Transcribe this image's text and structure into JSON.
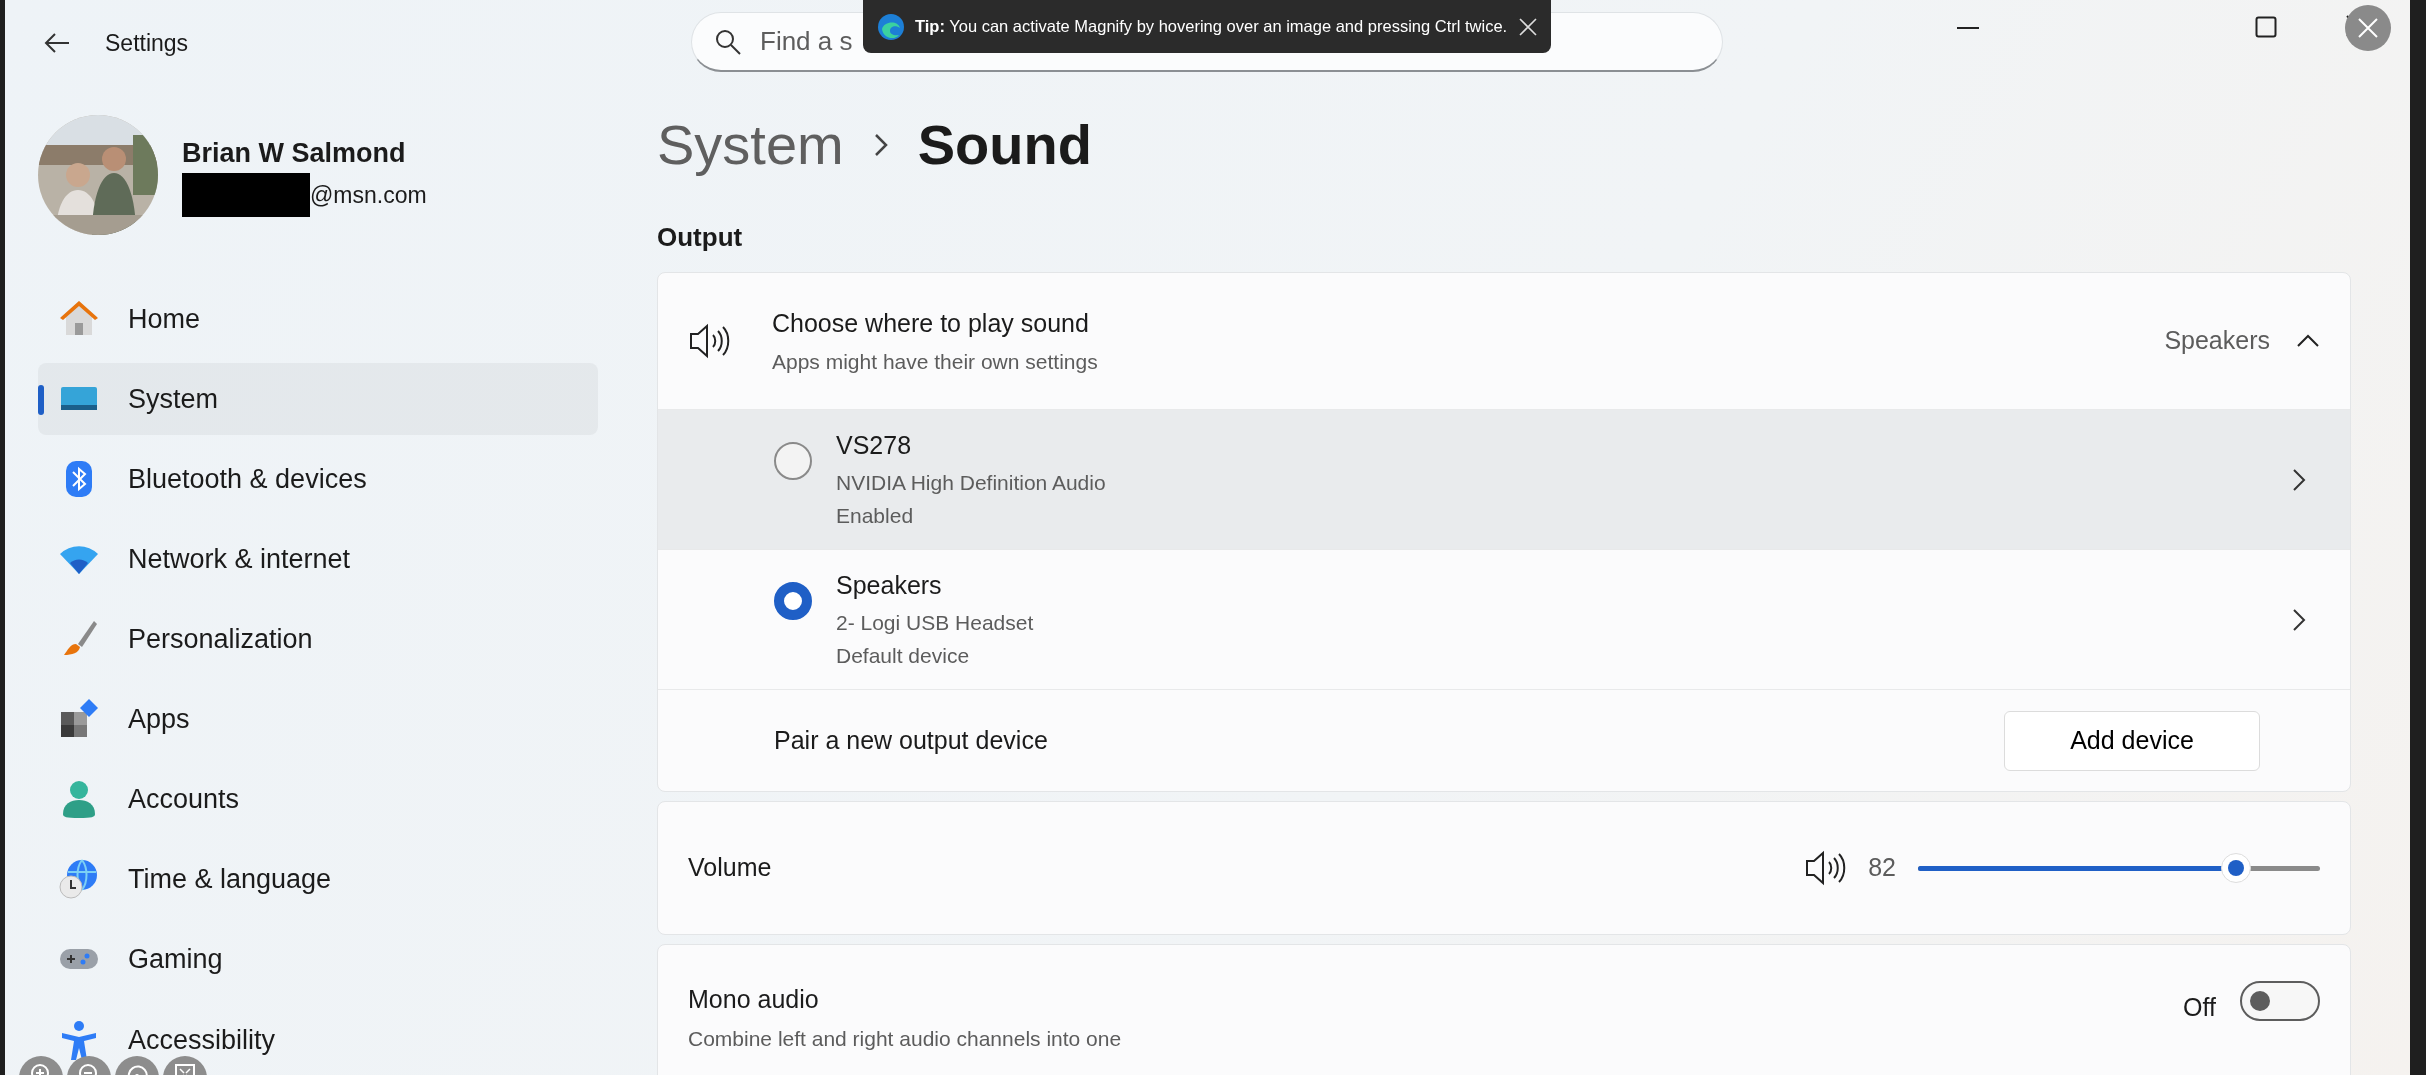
{
  "window": {
    "title": "Settings"
  },
  "search": {
    "placeholder": "Find a s"
  },
  "tip": {
    "text": "**Tip:** You can activate Magnify by hovering over an image and pressing Ctrl twice."
  },
  "profile": {
    "name": "Brian W Salmond",
    "email": "@msn.com"
  },
  "sidebar": {
    "items": [
      {
        "label": "Home",
        "selected": false
      },
      {
        "label": "System",
        "selected": true
      },
      {
        "label": "Bluetooth & devices",
        "selected": false
      },
      {
        "label": "Network & internet",
        "selected": false
      },
      {
        "label": "Personalization",
        "selected": false
      },
      {
        "label": "Apps",
        "selected": false
      },
      {
        "label": "Accounts",
        "selected": false
      },
      {
        "label": "Time & language",
        "selected": false
      },
      {
        "label": "Gaming",
        "selected": false
      },
      {
        "label": "Accessibility",
        "selected": false
      }
    ]
  },
  "breadcrumb": [
    "System",
    "Sound"
  ],
  "section": "Output",
  "output": {
    "title": "Choose where to play sound",
    "subtitle": "Apps might have their own settings",
    "value": "Speakers",
    "expanded": true,
    "devices": [
      {
        "name": "VS278",
        "driver": "NVIDIA High Definition Audio",
        "status": "Enabled",
        "selected": false,
        "highlighted": true
      },
      {
        "name": "Speakers",
        "driver": "2- Logi USB Headset",
        "status": "Default device",
        "selected": true,
        "highlighted": false
      }
    ],
    "pair": {
      "label": "Pair a new output device",
      "button": "Add device"
    }
  },
  "volume": {
    "label": "Volume",
    "reading": "82",
    "level": 0.79
  },
  "mono": {
    "title": "Mono audio",
    "subtitle": "Combine left and right audio channels into one",
    "state": "Off",
    "on": false
  }
}
